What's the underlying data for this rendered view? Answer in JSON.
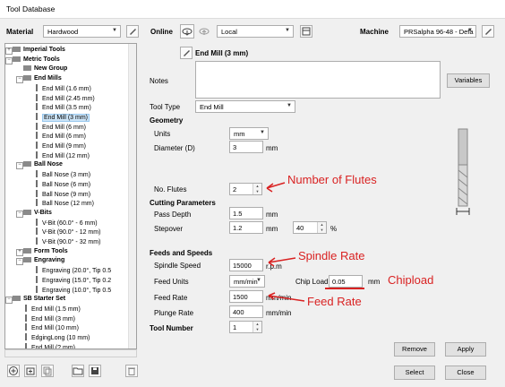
{
  "window": {
    "title": "Tool Database"
  },
  "header": {
    "material_label": "Material",
    "material_value": "Hardwood",
    "online_label": "Online",
    "location_value": "Local",
    "machine_label": "Machine",
    "machine_value": "PRSalpha 96-48 - Defa"
  },
  "tree": {
    "items": [
      {
        "label": "Imperial Tools",
        "bold": true
      },
      {
        "label": "Metric Tools",
        "bold": true
      },
      {
        "label": "New Group",
        "bold": true
      },
      {
        "label": "End Mills",
        "bold": true
      },
      {
        "label": "End Mill (1.6 mm)"
      },
      {
        "label": "End Mill (2.45 mm)"
      },
      {
        "label": "End Mill (3.5 mm)"
      },
      {
        "label": "End Mill (3 mm)",
        "selected": true
      },
      {
        "label": "End Mill (6 mm)"
      },
      {
        "label": "End Mill (6 mm)"
      },
      {
        "label": "End Mill (9 mm)"
      },
      {
        "label": "End Mill (12 mm)"
      },
      {
        "label": "Ball Nose",
        "bold": true
      },
      {
        "label": "Ball Nose (3 mm)"
      },
      {
        "label": "Ball Nose (6 mm)"
      },
      {
        "label": "Ball Nose (9 mm)"
      },
      {
        "label": "Ball Nose (12 mm)"
      },
      {
        "label": "V-Bits",
        "bold": true
      },
      {
        "label": "V-Bit (60.0° - 6 mm)"
      },
      {
        "label": "V-Bit (90.0° - 12 mm)"
      },
      {
        "label": "V-Bit (90.0° - 32 mm)"
      },
      {
        "label": "Form Tools",
        "bold": true
      },
      {
        "label": "Engraving",
        "bold": true
      },
      {
        "label": "Engraving (20.0°, Tip 0.5"
      },
      {
        "label": "Engraving (15.0°, Tip 0.2"
      },
      {
        "label": "Engraving (10.0°, Tip 0.5"
      },
      {
        "label": "SB Starter Set",
        "bold": true
      },
      {
        "label": "End Mill (1.5 mm)"
      },
      {
        "label": "End Mill (3 mm)"
      },
      {
        "label": "End Mill (10 mm)"
      },
      {
        "label": "EdgingLong (10 mm)"
      },
      {
        "label": "End Mill (? mm)"
      }
    ]
  },
  "form": {
    "tool_name": "End Mill (3 mm)",
    "notes_label": "Notes",
    "variables_button": "Variables",
    "tool_type_label": "Tool Type",
    "tool_type_value": "End Mill",
    "geometry_header": "Geometry",
    "units_label": "Units",
    "units_value": "mm",
    "diameter_label": "Diameter (D)",
    "diameter_value": "3",
    "diameter_unit": "mm",
    "flutes_label": "No. Flutes",
    "flutes_value": "2",
    "cutting_header": "Cutting Parameters",
    "pass_depth_label": "Pass Depth",
    "pass_depth_value": "1.5",
    "pass_depth_unit": "mm",
    "stepover_label": "Stepover",
    "stepover_value": "1.2",
    "stepover_unit": "mm",
    "stepover_pct_value": "40",
    "stepover_pct_unit": "%",
    "feeds_header": "Feeds and Speeds",
    "spindle_label": "Spindle Speed",
    "spindle_value": "15000",
    "spindle_unit": "r.p.m",
    "feed_units_label": "Feed Units",
    "feed_units_value": "mm/min",
    "chipload_label": "Chip Load",
    "chipload_value": "0.05",
    "chipload_unit": "mm",
    "feed_rate_label": "Feed Rate",
    "feed_rate_value": "1500",
    "feed_rate_unit": "mm/min",
    "plunge_label": "Plunge Rate",
    "plunge_value": "400",
    "plunge_unit": "mm/min",
    "tool_number_label": "Tool Number",
    "tool_number_value": "1"
  },
  "buttons": {
    "remove": "Remove",
    "apply": "Apply",
    "select": "Select",
    "close": "Close"
  },
  "annotations": {
    "flutes": "Number of Flutes",
    "spindle": "Spindle Rate",
    "chipload": "Chipload",
    "feed": "Feed Rate",
    "color": "#d92222"
  }
}
